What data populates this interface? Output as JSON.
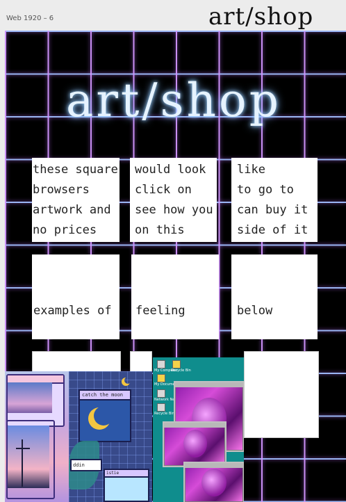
{
  "frame": {
    "label": "Web 1920 – 6",
    "header_title": "art/shop"
  },
  "hero": {
    "title": "art/shop"
  },
  "cards_top": [
    {
      "lines": [
        "these square",
        "browsers",
        "artwork and",
        "no prices"
      ]
    },
    {
      "lines": [
        "would look",
        "click on",
        "see how you",
        "on this"
      ]
    },
    {
      "lines": [
        "like",
        "to go to",
        "can buy it",
        "side of it"
      ]
    }
  ],
  "cards_middle": [
    {
      "text": "examples of"
    },
    {
      "text": "feeling"
    },
    {
      "text": "below"
    }
  ],
  "collage": {
    "moon_window_title": "catch the moon",
    "small_window_text": "ddin",
    "small_window_text2": "istie",
    "desktop_icons": [
      "My Computer",
      "Recycle Bin",
      "My Documents",
      "Network Neighborhood",
      "Recycle Bin"
    ]
  },
  "colors": {
    "canvas_bg": "#000000",
    "grid_line": "#d296ff",
    "hero_glow": "#9fd6ff",
    "card_bg": "#ffffff",
    "vapor_purple": "#d64cd8",
    "desktop_teal": "#0f8d8d"
  }
}
